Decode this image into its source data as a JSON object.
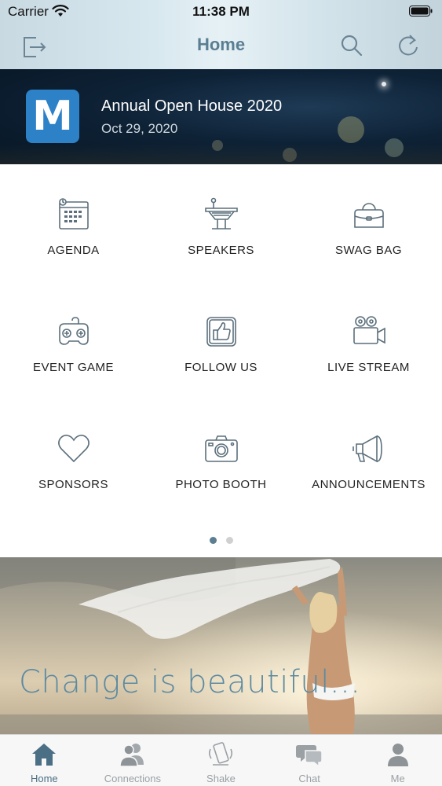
{
  "status_bar": {
    "carrier": "Carrier",
    "time": "11:38 PM"
  },
  "nav": {
    "title": "Home",
    "icons": [
      "logout-icon",
      "search-icon",
      "refresh-icon"
    ]
  },
  "event": {
    "logo_letter": "M",
    "title": "Annual Open House 2020",
    "date": "Oct 29, 2020",
    "logo_color": "#2d81c7"
  },
  "features": [
    {
      "label": "AGENDA",
      "icon": "calendar-icon"
    },
    {
      "label": "SPEAKERS",
      "icon": "podium-icon"
    },
    {
      "label": "SWAG BAG",
      "icon": "handbag-icon"
    },
    {
      "label": "EVENT GAME",
      "icon": "gamepad-icon"
    },
    {
      "label": "FOLLOW US",
      "icon": "thumbs-up-icon"
    },
    {
      "label": "LIVE STREAM",
      "icon": "video-camera-icon"
    },
    {
      "label": "SPONSORS",
      "icon": "heart-icon"
    },
    {
      "label": "PHOTO BOOTH",
      "icon": "camera-icon"
    },
    {
      "label": "ANNOUNCEMENTS",
      "icon": "megaphone-icon"
    }
  ],
  "pager": {
    "pages": 2,
    "current": 1
  },
  "promo": {
    "text": "Change is beautiful..."
  },
  "tabs": [
    {
      "label": "Home",
      "icon": "home-icon",
      "active": true
    },
    {
      "label": "Connections",
      "icon": "people-icon",
      "active": false
    },
    {
      "label": "Shake",
      "icon": "shake-phone-icon",
      "active": false
    },
    {
      "label": "Chat",
      "icon": "chat-icon",
      "active": false
    },
    {
      "label": "Me",
      "icon": "person-icon",
      "active": false
    }
  ],
  "colors": {
    "accent": "#5a7e92",
    "icon_stroke": "#5b6f7c",
    "tab_active": "#4b6f84",
    "tab_inactive": "#9aa0a4"
  }
}
